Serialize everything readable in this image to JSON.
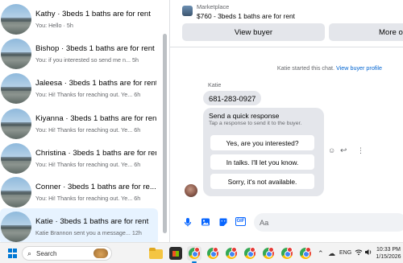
{
  "conversations": [
    {
      "title": "Kathy · 3beds 1 baths are for rent",
      "preview": "You: Hello ·",
      "age": "5h"
    },
    {
      "title": "Bishop · 3beds 1 baths are for rent",
      "preview": "You: if you interested so send me n...",
      "age": "5h"
    },
    {
      "title": "Jaleesa · 3beds 1 baths are for rent",
      "preview": "You: Hi! Thanks for reaching out. Ye...",
      "age": "6h"
    },
    {
      "title": "Kiyanna · 3beds 1 baths are for rent",
      "preview": "You: Hi! Thanks for reaching out. Ye...",
      "age": "6h"
    },
    {
      "title": "Christina · 3beds 1 baths are for rent",
      "preview": "You: Hi! Thanks for reaching out. Ye...",
      "age": "6h"
    },
    {
      "title": "Conner · 3beds 1 baths are for re...",
      "preview": "You: Hi! Thanks for reaching out. Ye...",
      "age": "6h"
    },
    {
      "title": "Katie · 3beds 1 baths are for rent",
      "preview": "Katie Brannon sent you a message...",
      "age": "12h"
    }
  ],
  "chat": {
    "listing_source": "Marketplace",
    "listing_title": "$760 - 3beds 1 baths are for rent",
    "view_buyer": "View buyer",
    "more": "More o",
    "started_text": "Katie started this chat.",
    "view_profile": "View buyer profile",
    "sender_name": "Katie",
    "phone": "681-283-0927",
    "quick_title": "Send a quick response",
    "quick_hint": "Tap a response to send it to the buyer.",
    "quick_responses": [
      "Yes, are you interested?",
      "In talks. I'll let you know.",
      "Sorry, it's not available."
    ],
    "input_placeholder": "Aa"
  },
  "taskbar": {
    "search_label": "Search",
    "language": "ENG",
    "time": "10:33 PM",
    "date": "1/15/2026"
  },
  "colors": {
    "accent": "#0866ff",
    "link": "#0064d1",
    "selected_row": "#e7f3ff",
    "bubble": "#e4e6eb"
  }
}
